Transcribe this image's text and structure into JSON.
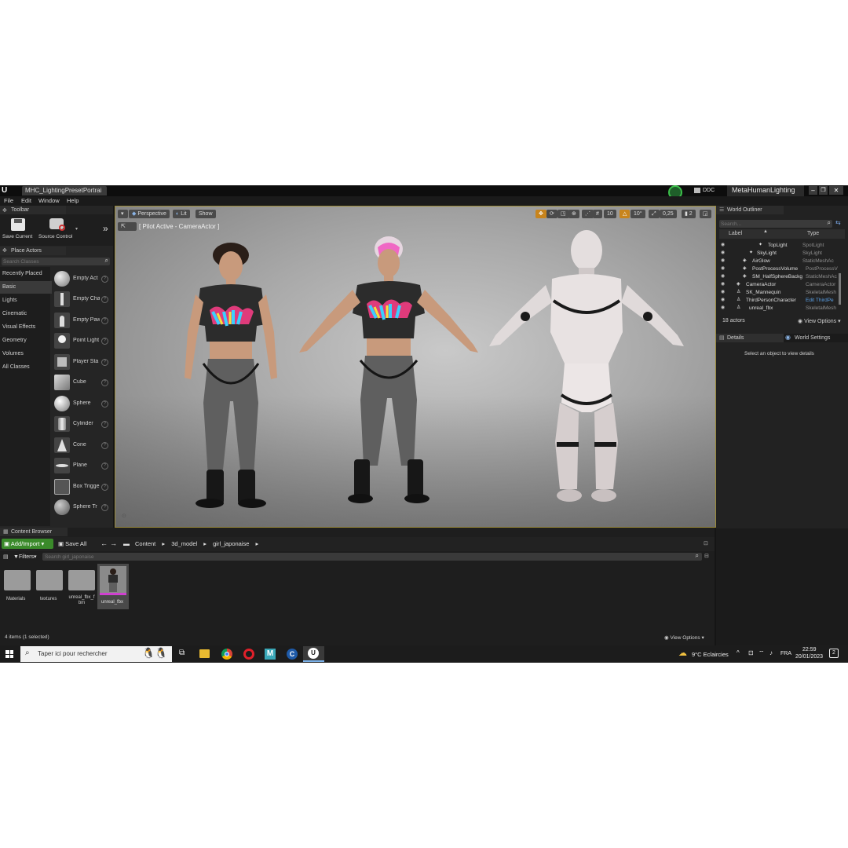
{
  "window": {
    "tab_title": "MHC_LightingPresetPortrai",
    "ddc_label": "DDC",
    "project_name": "MetaHumanLighting"
  },
  "menu": [
    "File",
    "Edit",
    "Window",
    "Help"
  ],
  "toolbar": {
    "title": "Toolbar",
    "save_label": "Save Current",
    "source_control_label": "Source Control"
  },
  "place_actors": {
    "title": "Place Actors",
    "search_placeholder": "Search Classes",
    "categories": [
      "Recently Placed",
      "Basic",
      "Lights",
      "Cinematic",
      "Visual Effects",
      "Geometry",
      "Volumes",
      "All Classes"
    ],
    "selected_category": "Basic",
    "items": [
      "Empty Act",
      "Empty Cha",
      "Empty Paw",
      "Point Light",
      "Player Sta",
      "Cube",
      "Sphere",
      "Cylinder",
      "Cone",
      "Plane",
      "Box Trigge",
      "Sphere Tr"
    ]
  },
  "viewport": {
    "perspective_label": "Perspective",
    "lit_label": "Lit",
    "show_label": "Show",
    "pilot_text": "[ Pilot Active - CameraActor ]",
    "grid_snap": "10",
    "rotation_snap": "10°",
    "scale_snap": "0,25",
    "camera_speed": "2"
  },
  "world_outliner": {
    "title": "World Outliner",
    "search_placeholder": "Search...",
    "col_label": "Label",
    "col_type": "Type",
    "rows": [
      {
        "label": "TopLight",
        "type": "SpotLight"
      },
      {
        "label": "SkyLight",
        "type": "SkyLight"
      },
      {
        "label": "AirGlow",
        "type": "StaticMeshAc"
      },
      {
        "label": "PostProcessVolume",
        "type": "PostProcessV"
      },
      {
        "label": "SM_HalfSphereBackg",
        "type": "StaticMeshAc"
      },
      {
        "label": "CameraActor",
        "type": "CameraActor"
      },
      {
        "label": "SK_Mannequin",
        "type": "SkeletalMesh"
      },
      {
        "label": "ThirdPersonCharacter",
        "type": "Edit ThirdPe"
      },
      {
        "label": "unreal_fbx",
        "type": "SkeletalMesh"
      }
    ],
    "actor_count": "18 actors",
    "view_options": "View Options"
  },
  "details": {
    "tab_details": "Details",
    "tab_world_settings": "World Settings",
    "empty_text": "Select an object to view details"
  },
  "content_browser": {
    "title": "Content Browser",
    "add_import": "Add/Import",
    "save_all": "Save All",
    "path": [
      "Content",
      "3d_model",
      "girl_japonaise"
    ],
    "filters": "Filters",
    "search_placeholder": "Search girl_japonaise",
    "assets": [
      "Materials",
      "textures",
      "unreal_fbx_fbm",
      "unreal_fbx"
    ],
    "status": "4 items (1 selected)",
    "view_options": "View Options"
  },
  "taskbar": {
    "search_placeholder": "Taper ici pour rechercher",
    "weather": "9°C  Eclaircies",
    "language": "FRA",
    "time": "22:59",
    "date": "20/01/2023",
    "notification_count": "2"
  },
  "colors": {
    "accent_orange": "#c8841c",
    "add_import_green": "#3a8a2a",
    "selection_blue": "#3e6ea8",
    "edit_link": "#5aa0e6"
  }
}
